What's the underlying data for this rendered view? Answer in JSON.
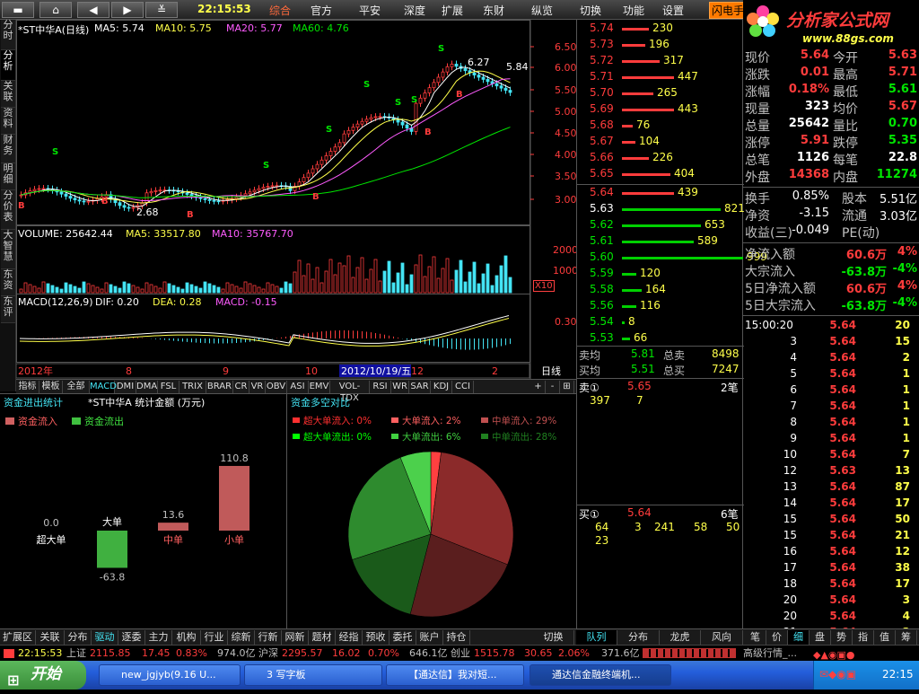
{
  "toolbar": {
    "time": "22:15:53",
    "menus": [
      "综合",
      "官方",
      "平安",
      "深度",
      "扩展",
      "东财",
      "纵览",
      "切换",
      "功能",
      "设置"
    ],
    "flash": "闪电手",
    "logo_text": "分析家公式网",
    "logo_url": "www.88gs.com",
    "stock_name_faint": "*ST中华A"
  },
  "left_tabs": [
    "分时",
    "分析",
    "关联",
    "资料",
    "财务",
    "明细",
    "分价表",
    "大智慧",
    "东资",
    "东评"
  ],
  "chart": {
    "header": "*ST中华A(日线)",
    "ma5": "MA5: 5.74",
    "ma10": "MA10: 5.75",
    "ma20": "MA20: 5.77",
    "ma60": "MA60: 4.76",
    "price_ticks": [
      "6.50",
      "6.00",
      "5.50",
      "5.00",
      "4.50",
      "4.00",
      "3.50",
      "3.00"
    ],
    "high_label": "6.27",
    "last_label": "5.84",
    "low_label": "2.68",
    "volume_header": "VOLUME: 25642.44",
    "vol_ma5": "MA5: 33517.80",
    "vol_ma10": "MA10: 35767.70",
    "vol_ticks": [
      "20000",
      "10000"
    ],
    "vol_unit": "X10",
    "macd_header": "MACD(12,26,9)",
    "dif": "DIF: 0.20",
    "dea": "DEA: 0.28",
    "macd": "MACD: -0.15",
    "macd_tick": "0.30",
    "dates": [
      "2012年",
      "8",
      "9",
      "10",
      "12",
      "2"
    ],
    "date_highlight": "2012/10/19/五",
    "period": "日线"
  },
  "indicator_tabs": [
    "指标",
    "模板",
    "全部",
    "MACD",
    "DMI",
    "DMA",
    "FSL",
    "TRIX",
    "BRAR",
    "CR",
    "VR",
    "OBV",
    "ASI",
    "EMV",
    "VOL-TDX",
    "RSI",
    "WR",
    "SAR",
    "KDJ",
    "CCI"
  ],
  "indicator_buttons": [
    "+",
    "-",
    "⊞"
  ],
  "fund_panel": {
    "title": "资金进出统计",
    "subtitle": "*ST中华A 统计金额 (万元)",
    "legend_in": "资金流入",
    "legend_out": "资金流出",
    "bars": [
      {
        "label": "超大单",
        "value": 0.0,
        "value_text": "0.0"
      },
      {
        "label": "大单",
        "value": -63.8,
        "value_text": "-63.8"
      },
      {
        "label": "中单",
        "value": 13.6,
        "value_text": "13.6"
      },
      {
        "label": "小单",
        "value": 110.8,
        "value_text": "110.8"
      }
    ]
  },
  "pie_panel": {
    "title": "资金多空对比",
    "legend": [
      {
        "text": "超大单流入: 0%",
        "color": "#ff3030"
      },
      {
        "text": "大单流入: 2%",
        "color": "#ff6060"
      },
      {
        "text": "中单流入: 29%",
        "color": "#c05050"
      },
      {
        "text": "超大单流出: 0%",
        "color": "#00ff00"
      },
      {
        "text": "大单流出: 6%",
        "color": "#40d040"
      },
      {
        "text": "中单流出: 28%",
        "color": "#208020"
      }
    ],
    "slices": [
      {
        "pct": 2,
        "color": "#ff4040"
      },
      {
        "pct": 29,
        "color": "#8b2a2a"
      },
      {
        "pct": 23,
        "color": "#5a1e1e"
      },
      {
        "pct": 16,
        "color": "#1a5a1a"
      },
      {
        "pct": 24,
        "color": "#2e8b2e"
      },
      {
        "pct": 6,
        "color": "#4cd04c"
      }
    ]
  },
  "order_book": {
    "asks": [
      {
        "price": "5.74",
        "vol": "230",
        "bar": 30
      },
      {
        "price": "5.73",
        "vol": "196",
        "bar": 26
      },
      {
        "price": "5.72",
        "vol": "317",
        "bar": 42
      },
      {
        "price": "5.71",
        "vol": "447",
        "bar": 58
      },
      {
        "price": "5.70",
        "vol": "265",
        "bar": 35
      },
      {
        "price": "5.69",
        "vol": "443",
        "bar": 58
      },
      {
        "price": "5.68",
        "vol": "76",
        "bar": 12
      },
      {
        "price": "5.67",
        "vol": "104",
        "bar": 15
      },
      {
        "price": "5.66",
        "vol": "226",
        "bar": 30
      },
      {
        "price": "5.65",
        "vol": "404",
        "bar": 54
      }
    ],
    "bids": [
      {
        "price": "5.64",
        "vol": "439",
        "bar": 58,
        "pcolor": "red",
        "barcolor": "#ff3c3c"
      },
      {
        "price": "5.63",
        "vol": "821",
        "bar": 110,
        "pcolor": "white",
        "barcolor": "#00d000"
      },
      {
        "price": "5.62",
        "vol": "653",
        "bar": 88,
        "pcolor": "green",
        "barcolor": "#00d000"
      },
      {
        "price": "5.61",
        "vol": "589",
        "bar": 80,
        "pcolor": "green",
        "barcolor": "#00d000"
      },
      {
        "price": "5.60",
        "vol": "999",
        "bar": 135,
        "pcolor": "green",
        "barcolor": "#00d000"
      },
      {
        "price": "5.59",
        "vol": "120",
        "bar": 16,
        "pcolor": "green",
        "barcolor": "#00d000"
      },
      {
        "price": "5.58",
        "vol": "164",
        "bar": 22,
        "pcolor": "green",
        "barcolor": "#00d000"
      },
      {
        "price": "5.56",
        "vol": "116",
        "bar": 16,
        "pcolor": "green",
        "barcolor": "#00d000"
      },
      {
        "price": "5.54",
        "vol": "8",
        "bar": 3,
        "pcolor": "green",
        "barcolor": "#00d000"
      },
      {
        "price": "5.53",
        "vol": "66",
        "bar": 9,
        "pcolor": "green",
        "barcolor": "#00d000"
      }
    ],
    "avg_sell_label": "卖均",
    "avg_sell": "5.81",
    "total_sell_label": "总卖",
    "total_sell": "8498",
    "avg_buy_label": "买均",
    "avg_buy": "5.51",
    "total_buy_label": "总买",
    "total_buy": "7247",
    "sell1_label": "卖①",
    "sell1_price": "5.65",
    "sell1_count": "2笔",
    "sell1_vols": [
      "397",
      "7"
    ],
    "buy1_label": "买①",
    "buy1_price": "5.64",
    "buy1_count": "6笔",
    "buy1_vols": [
      "64",
      "3",
      "241",
      "58",
      "50",
      "23"
    ],
    "tabs": [
      "队列",
      "分布",
      "龙虎",
      "风向"
    ]
  },
  "quote": {
    "rows": [
      {
        "l1": "现价",
        "v1": "5.64",
        "c1": "red",
        "l2": "今开",
        "v2": "5.63",
        "c2": "red"
      },
      {
        "l1": "涨跌",
        "v1": "0.01",
        "c1": "red",
        "l2": "最高",
        "v2": "5.71",
        "c2": "red"
      },
      {
        "l1": "涨幅",
        "v1": "0.18%",
        "c1": "red",
        "l2": "最低",
        "v2": "5.61",
        "c2": "green"
      },
      {
        "l1": "现量",
        "v1": "323",
        "c1": "white",
        "l2": "均价",
        "v2": "5.67",
        "c2": "red"
      },
      {
        "l1": "总量",
        "v1": "25642",
        "c1": "white",
        "l2": "量比",
        "v2": "0.70",
        "c2": "green"
      },
      {
        "l1": "涨停",
        "v1": "5.91",
        "c1": "red",
        "l2": "跌停",
        "v2": "5.35",
        "c2": "green"
      },
      {
        "l1": "总笔",
        "v1": "1126",
        "c1": "white",
        "l2": "每笔",
        "v2": "22.8",
        "c2": "white"
      },
      {
        "l1": "外盘",
        "v1": "14368",
        "c1": "red",
        "l2": "内盘",
        "v2": "11274",
        "c2": "green"
      }
    ],
    "rows2": [
      {
        "l1": "换手",
        "v1": "0.85%",
        "l2": "股本",
        "v2": "5.51亿"
      },
      {
        "l1": "净资",
        "v1": "-3.15",
        "l2": "流通",
        "v2": "3.03亿"
      },
      {
        "l1": "收益(三)",
        "v1": "-0.049",
        "l2": "PE(动)",
        "v2": ""
      }
    ],
    "flows": [
      {
        "label": "净流入额",
        "value": "60.6万",
        "color": "red",
        "pct": "4%",
        "pcolor": "red"
      },
      {
        "label": "大宗流入",
        "value": "-63.8万",
        "color": "green",
        "pct": "-4%",
        "pcolor": "green"
      },
      {
        "label": "5日净流入额",
        "value": "60.6万",
        "color": "red",
        "pct": "4%",
        "pcolor": "red"
      },
      {
        "label": "5日大宗流入",
        "value": "-63.8万",
        "color": "green",
        "pct": "-4%",
        "pcolor": "green"
      }
    ]
  },
  "ticks": [
    {
      "t": "15:00:20",
      "p": "5.64",
      "v": "20"
    },
    {
      "t": "3",
      "p": "5.64",
      "v": "15"
    },
    {
      "t": "4",
      "p": "5.64",
      "v": "2"
    },
    {
      "t": "5",
      "p": "5.64",
      "v": "1"
    },
    {
      "t": "6",
      "p": "5.64",
      "v": "1"
    },
    {
      "t": "7",
      "p": "5.64",
      "v": "1"
    },
    {
      "t": "8",
      "p": "5.64",
      "v": "1"
    },
    {
      "t": "9",
      "p": "5.64",
      "v": "1"
    },
    {
      "t": "10",
      "p": "5.64",
      "v": "7"
    },
    {
      "t": "12",
      "p": "5.63",
      "v": "13"
    },
    {
      "t": "13",
      "p": "5.64",
      "v": "87"
    },
    {
      "t": "14",
      "p": "5.64",
      "v": "17"
    },
    {
      "t": "15",
      "p": "5.64",
      "v": "50"
    },
    {
      "t": "15",
      "p": "5.64",
      "v": "21"
    },
    {
      "t": "16",
      "p": "5.64",
      "v": "12"
    },
    {
      "t": "17",
      "p": "5.64",
      "v": "38"
    },
    {
      "t": "18",
      "p": "5.64",
      "v": "17"
    },
    {
      "t": "20",
      "p": "5.64",
      "v": "3"
    },
    {
      "t": "20",
      "p": "5.64",
      "v": "4"
    },
    {
      "t": "21",
      "p": "5.64",
      "v": "2"
    }
  ],
  "right_tabs": [
    "笔",
    "价",
    "细",
    "盘",
    "势",
    "指",
    "值",
    "筹"
  ],
  "bottom_tabs": [
    "扩展区",
    "关联",
    "分布",
    "驱动",
    "逐委",
    "主力",
    "机构",
    "行业",
    "综新",
    "行新",
    "网新",
    "题材",
    "经指",
    "预收",
    "委托",
    "账户",
    "持仓"
  ],
  "switch_label": "切换",
  "status": {
    "time": "22:15:53",
    "sh_label": "上证",
    "sh": "2115.85",
    "sh_chg": "17.45",
    "sh_pct": "0.83%",
    "sh_amt": "974.0亿",
    "sz_label": "沪深",
    "sz": "2295.57",
    "sz_chg": "16.02",
    "sz_pct": "0.70%",
    "sz_amt": "646.1亿",
    "cy_label": "创业",
    "cy": "1515.78",
    "cy_chg": "30.65",
    "cy_pct": "2.06%",
    "cy_amt": "371.6亿",
    "right": "高级行情_..."
  },
  "taskbar": {
    "start": "开始",
    "tasks": [
      "new_jgjyb(9.16 U...",
      "3 写字板",
      "【通达信】我对短...",
      "通达信金融终端机..."
    ],
    "clock": "22:15"
  }
}
